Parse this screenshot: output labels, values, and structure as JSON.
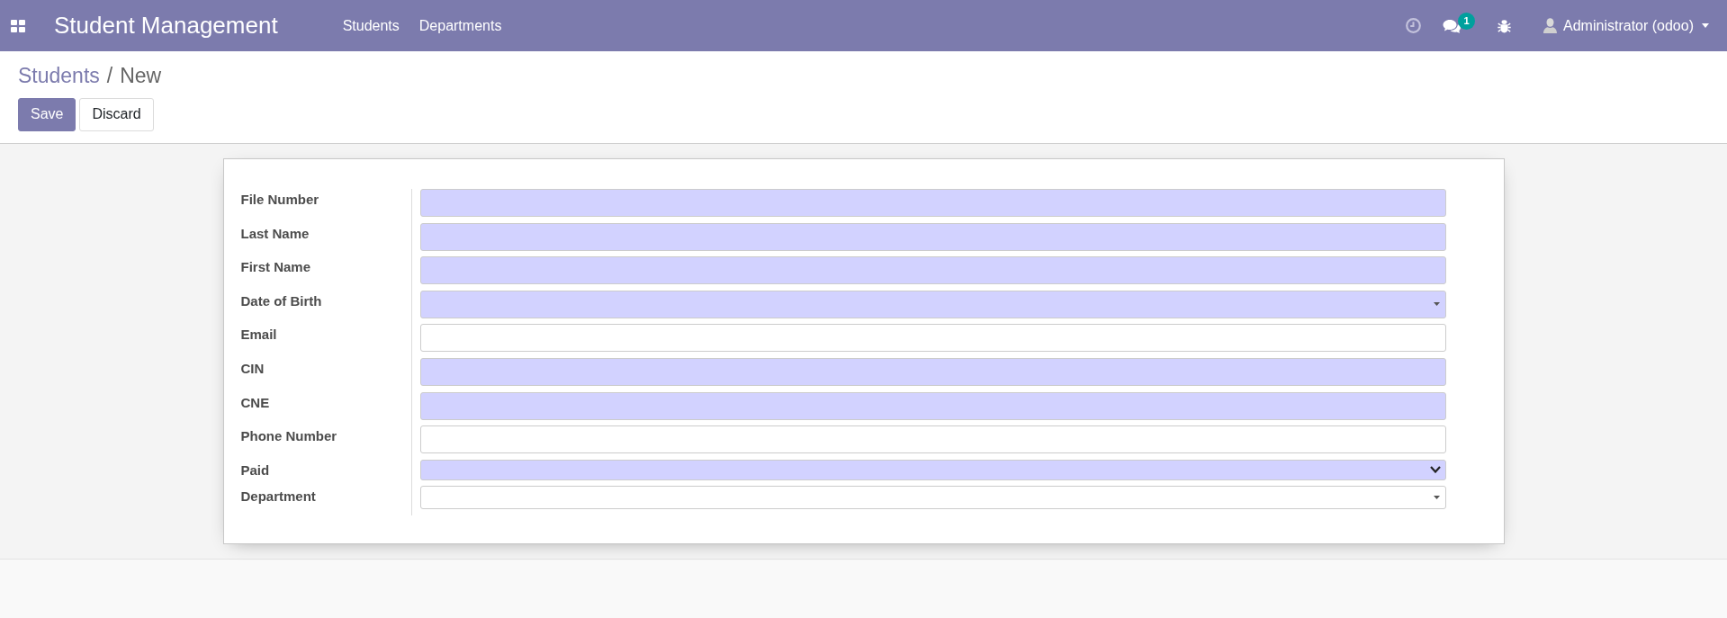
{
  "navbar": {
    "brand": "Student Management",
    "menu": [
      {
        "label": "Students"
      },
      {
        "label": "Departments"
      }
    ],
    "messages_badge": "1",
    "user": {
      "name": "Administrator (odoo)"
    }
  },
  "breadcrumb": {
    "items": [
      {
        "label": "Students",
        "kind": "link"
      },
      {
        "label": "New",
        "kind": "current"
      }
    ],
    "separator": "/"
  },
  "buttons": [
    {
      "label": "Save",
      "kind": "primary"
    },
    {
      "label": "Discard",
      "kind": "secondary"
    }
  ],
  "form": {
    "fields": [
      {
        "label": "File Number",
        "kind": "text",
        "required": true
      },
      {
        "label": "Last Name",
        "kind": "text",
        "required": true
      },
      {
        "label": "First Name",
        "kind": "text",
        "required": true
      },
      {
        "label": "Date of Birth",
        "kind": "date",
        "required": true
      },
      {
        "label": "Email",
        "kind": "text",
        "required": false
      },
      {
        "label": "CIN",
        "kind": "text",
        "required": true
      },
      {
        "label": "CNE",
        "kind": "text",
        "required": true
      },
      {
        "label": "Phone Number",
        "kind": "text",
        "required": false
      },
      {
        "label": "Paid",
        "kind": "selection",
        "required": true
      },
      {
        "label": "Department",
        "kind": "many2one",
        "required": false
      }
    ]
  }
}
